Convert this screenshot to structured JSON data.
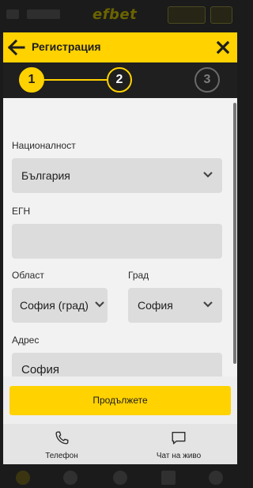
{
  "background": {
    "logo_text": "efbet"
  },
  "header": {
    "title": "Регистрация"
  },
  "steps": [
    {
      "number": "1",
      "state": "done"
    },
    {
      "number": "2",
      "state": "active"
    },
    {
      "number": "3",
      "state": "upcoming"
    }
  ],
  "form": {
    "nationality": {
      "label": "Националност",
      "value": "България"
    },
    "egn": {
      "label": "ЕГН",
      "value": ""
    },
    "region": {
      "label": "Област",
      "value": "София (град)"
    },
    "city": {
      "label": "Град",
      "value": "София"
    },
    "address": {
      "label": "Адрес",
      "value": "София"
    }
  },
  "footer": {
    "continue_label": "Продължете",
    "phone_label": "Телефон",
    "chat_label": "Чат на живо"
  },
  "colors": {
    "accent": "#ffd200",
    "dark": "#1f1f1f",
    "field": "#dcdcdc"
  },
  "icons": [
    "back-arrow-icon",
    "close-icon",
    "chevron-down-icon",
    "phone-icon",
    "chat-icon"
  ]
}
